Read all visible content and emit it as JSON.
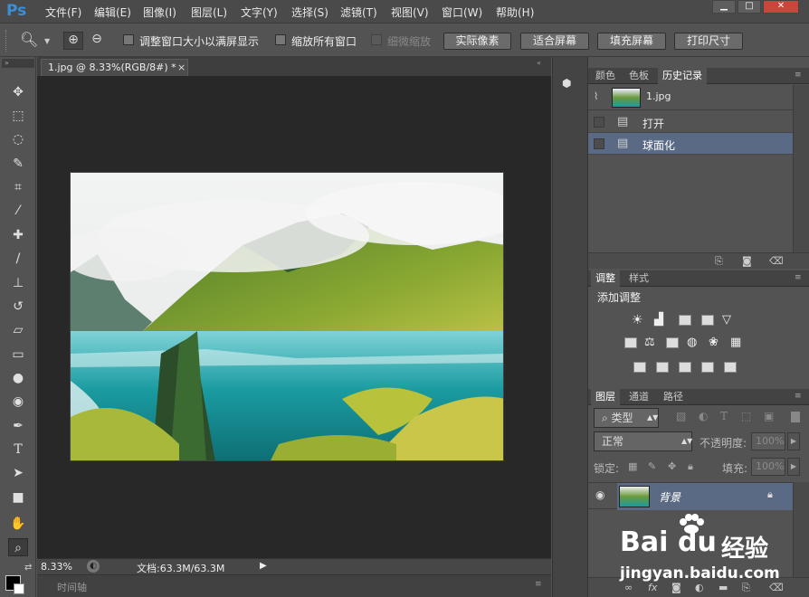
{
  "app": {
    "logo": "Ps"
  },
  "menubar": {
    "items": [
      "文件(F)",
      "编辑(E)",
      "图像(I)",
      "图层(L)",
      "文字(Y)",
      "选择(S)",
      "滤镜(T)",
      "视图(V)",
      "窗口(W)",
      "帮助(H)"
    ],
    "window_controls": [
      "▁",
      "□",
      "✕"
    ]
  },
  "options": {
    "checkbox1": "调整窗口大小以满屏显示",
    "checkbox2": "缩放所有窗口",
    "checkbox3": "细微缩放",
    "btn_actual": "实际像素",
    "btn_fit": "适合屏幕",
    "btn_fill": "填充屏幕",
    "btn_print": "打印尺寸"
  },
  "document": {
    "tab_title": "1.jpg @ 8.33%(RGB/8#) *",
    "close": "×",
    "zoom": "8.33%",
    "doc_info": "文档:63.3M/63.3M",
    "timeline_label": "时间轴"
  },
  "panels": {
    "top_tabs": [
      "颜色",
      "色板",
      "历史记录"
    ],
    "history": {
      "snapshot": "1.jpg",
      "items": [
        "打开",
        "球面化"
      ]
    },
    "adjust_tabs": [
      "调整",
      "样式"
    ],
    "adjust_title": "添加调整",
    "layers_tabs": [
      "图层",
      "通道",
      "路径"
    ],
    "layers": {
      "filter_kind": "类型",
      "blend_mode": "正常",
      "opacity_label": "不透明度:",
      "opacity_value": "100%",
      "lock_label": "锁定:",
      "fill_label": "填充:",
      "fill_value": "100%",
      "layer_name": "背景"
    }
  },
  "watermark": {
    "brand": "Bai",
    "brand2": "du",
    "cn": "经验",
    "url": "jingyan.baidu.com"
  }
}
